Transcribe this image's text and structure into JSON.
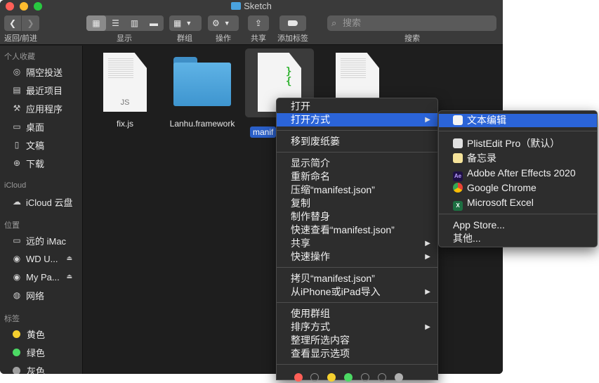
{
  "window": {
    "title": "Sketch"
  },
  "toolbar": {
    "back_forward_label": "返回/前进",
    "view_label": "显示",
    "group_label": "群组",
    "action_label": "操作",
    "share_label": "共享",
    "add_tag_label": "添加标签",
    "search_label": "搜索",
    "search_placeholder": "搜索"
  },
  "sidebar": {
    "favorites_header": "个人收藏",
    "favorites": [
      {
        "label": "隔空投送",
        "icon": "airdrop-icon"
      },
      {
        "label": "最近项目",
        "icon": "recents-icon"
      },
      {
        "label": "应用程序",
        "icon": "applications-icon"
      },
      {
        "label": "桌面",
        "icon": "desktop-icon"
      },
      {
        "label": "文稿",
        "icon": "documents-icon"
      },
      {
        "label": "下载",
        "icon": "downloads-icon"
      }
    ],
    "icloud_header": "iCloud",
    "icloud_drive": "iCloud 云盘",
    "locations_header": "位置",
    "locations": [
      {
        "label": "远的 iMac"
      },
      {
        "label": "WD U..."
      },
      {
        "label": "My Pa..."
      },
      {
        "label": "网络"
      }
    ],
    "tags_header": "标签",
    "tags": [
      {
        "label": "黄色",
        "color": "#f5d02f"
      },
      {
        "label": "绿色",
        "color": "#4cd964"
      },
      {
        "label": "灰色",
        "color": "#a0a0a0"
      }
    ]
  },
  "files": [
    {
      "name": "fix.js",
      "badge": "JS"
    },
    {
      "name": "Lanhu.framework"
    },
    {
      "name": "manifest.json",
      "selected_visible_text": "manif"
    },
    {
      "name": ""
    }
  ],
  "context_menu": {
    "items": {
      "open": "打开",
      "open_with": "打开方式",
      "move_to_trash": "移到废纸篓",
      "get_info": "显示简介",
      "rename": "重新命名",
      "compress": "压缩“manifest.json”",
      "duplicate": "复制",
      "make_alias": "制作替身",
      "quick_look": "快速查看“manifest.json”",
      "share": "共享",
      "quick_actions": "快速操作",
      "copy": "拷贝“manifest.json”",
      "import_from_iphone": "从iPhone或iPad导入",
      "use_groups": "使用群组",
      "sort_by": "排序方式",
      "clean_up_selection": "整理所选内容",
      "show_view_options": "查看显示选项"
    },
    "tag_colors": [
      "#ff5f57",
      "",
      "#f5d02f",
      "#4cd964",
      "",
      "",
      "#b0b0b0"
    ]
  },
  "submenu": {
    "default_app": "文本编辑",
    "apps": [
      {
        "label": "PlistEdit Pro（默认）",
        "icon": "plistedit-icon"
      },
      {
        "label": "备忘录",
        "icon": "notes-icon"
      },
      {
        "label": "Adobe After Effects 2020",
        "icon": "after-effects-icon",
        "glyph": "Ae"
      },
      {
        "label": "Google Chrome",
        "icon": "chrome-icon"
      },
      {
        "label": "Microsoft Excel",
        "icon": "excel-icon",
        "glyph": "X"
      }
    ],
    "app_store": "App Store...",
    "other": "其他..."
  }
}
